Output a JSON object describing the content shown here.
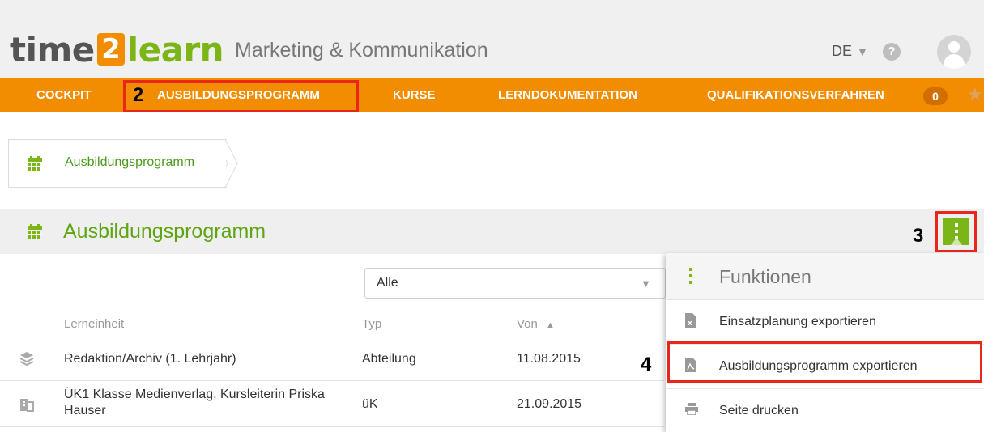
{
  "header": {
    "logo": {
      "part1": "time",
      "part2": "2",
      "part3": "learn"
    },
    "organization": "Marketing & Kommunikation",
    "language": "DE",
    "help_icon": "question-circle-icon",
    "avatar_icon": "user-avatar-icon"
  },
  "nav": {
    "items": [
      {
        "label": "COCKPIT"
      },
      {
        "label": "AUSBILDUNGSPROGRAMM"
      },
      {
        "label": "KURSE"
      },
      {
        "label": "LERNDOKUMENTATION"
      },
      {
        "label": "QUALIFIKATIONSVERFAHREN"
      }
    ],
    "badge_count": "0",
    "star_icon": "star-icon"
  },
  "annotations": {
    "step2": "2",
    "step3": "3",
    "step4": "4",
    "highlight_color": "#e8261c"
  },
  "breadcrumb": {
    "label": "Ausbildungsprogramm",
    "icon": "calendar-icon"
  },
  "section": {
    "title": "Ausbildungsprogramm",
    "icon": "calendar-icon",
    "function_button_icon": "vertical-dots-icon"
  },
  "filter": {
    "selected": "Alle"
  },
  "table": {
    "columns": [
      "Lerneinheit",
      "Typ",
      "Von"
    ],
    "sort_indicator": "▲",
    "rows": [
      {
        "icon": "layers-icon",
        "lerneinheit": "Redaktion/Archiv (1. Lehrjahr)",
        "typ": "Abteilung",
        "von": "11.08.2015"
      },
      {
        "icon": "building-icon",
        "lerneinheit_line1": "ÜK1 Klasse Medienverlag, Kursleiterin Priska",
        "lerneinheit_line2": "Hauser",
        "typ": "üK",
        "von": "21.09.2015"
      }
    ]
  },
  "menu": {
    "title": "Funktionen",
    "items": [
      {
        "label": "Einsatzplanung exportieren",
        "icon": "excel-file-icon"
      },
      {
        "label": "Ausbildungsprogramm exportieren",
        "icon": "pdf-file-icon"
      },
      {
        "label": "Seite drucken",
        "icon": "printer-icon"
      }
    ]
  },
  "colors": {
    "orange": "#f28c00",
    "green": "#7cb518",
    "red": "#e8261c"
  }
}
